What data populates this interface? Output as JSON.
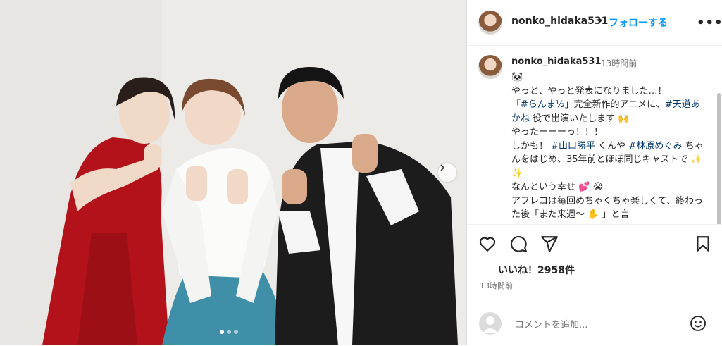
{
  "post": {
    "username": "nonko_hidaka531",
    "separator": "•",
    "follow_label": "フォローする",
    "more_label": "•••",
    "caption_time": "13時間前",
    "caption": {
      "line0": "🐼",
      "line1": "やっと、やっと発表になりました…！",
      "line2a": "「",
      "tag1": "#らんま½",
      "line2b": "」完全新作的アニメに、",
      "tag2": "#天道あかね",
      "line3b": " 役で出演いたします 🙌",
      "line4": "やったーーーっ！！！",
      "line5a": "しかも！ ",
      "tag3": "#山口勝平",
      "line5b": " くんや ",
      "tag4": "#林原めぐみ",
      "line6b": " ちゃんをはじめ、35年前とほぼ同じキャストで ✨ ✨",
      "line7": "なんという幸せ 💕 😭",
      "line8": "アフレコは毎回めちゃくちゃ楽しくて、終わった後「また来週〜 ✋ 」と言"
    },
    "likes": "いいね！2958件",
    "posted_time": "13時間前",
    "comment_placeholder": "コメントを追加...",
    "carousel": {
      "slides": 3,
      "active": 1
    }
  },
  "icons": {
    "like": "heart-icon",
    "comment": "comment-icon",
    "share": "share-icon",
    "save": "bookmark-icon",
    "emoji": "emoji-icon",
    "next": "chevron-right-icon"
  },
  "colors": {
    "follow": "#0095f6",
    "hashtag": "#00376b",
    "muted": "#737373",
    "text": "#262626"
  }
}
